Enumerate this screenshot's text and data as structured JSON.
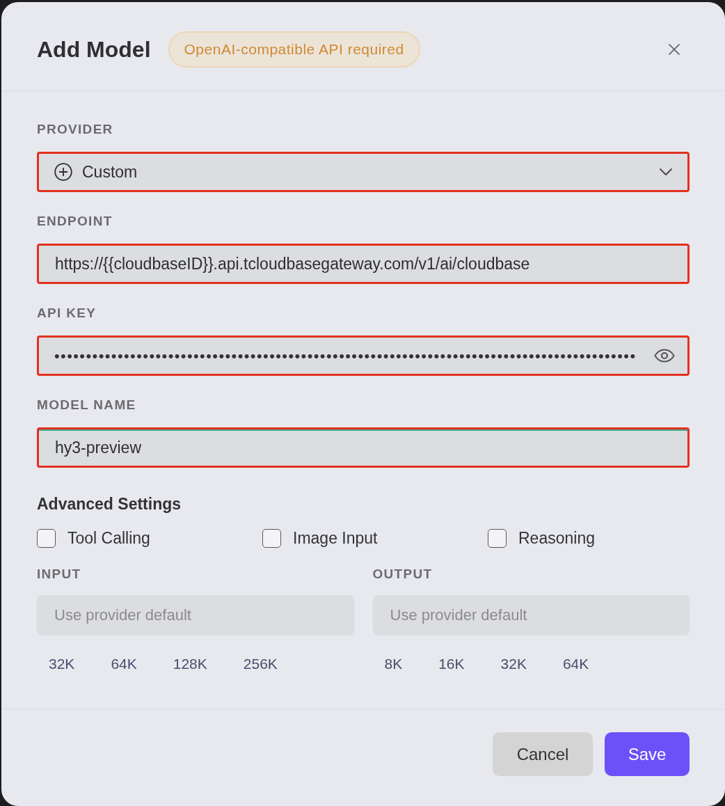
{
  "dialog": {
    "title": "Add Model",
    "badge": "OpenAI-compatible API required"
  },
  "fields": [
    {
      "label": "PROVIDER",
      "kind": "select",
      "value": "Custom",
      "highlighted": true,
      "focused": false
    },
    {
      "label": "ENDPOINT",
      "kind": "text",
      "value": "https://{{cloudbaseID}}.api.tcloudbasegateway.com/v1/ai/cloudbase",
      "highlighted": true,
      "focused": false
    },
    {
      "label": "API KEY",
      "kind": "password",
      "value": "••••••••••••••••••••••••••••••••••••••••••••••••••••••••••••••••••••••••••••••••••••••••••••",
      "highlighted": true,
      "focused": false
    },
    {
      "label": "MODEL NAME",
      "kind": "text",
      "value": "hy3-preview",
      "highlighted": true,
      "focused": true
    }
  ],
  "advanced_settings": {
    "title": "Advanced Settings",
    "options": [
      {
        "label": "Tool Calling",
        "checked": false
      },
      {
        "label": "Image Input",
        "checked": false
      },
      {
        "label": "Reasoning",
        "checked": false
      }
    ],
    "limits": [
      {
        "label": "INPUT",
        "placeholder": "Use provider default",
        "presets": [
          "32K",
          "64K",
          "128K",
          "256K"
        ]
      },
      {
        "label": "OUTPUT",
        "placeholder": "Use provider default",
        "presets": [
          "8K",
          "16K",
          "32K",
          "64K"
        ]
      }
    ]
  },
  "buttons": [
    {
      "label": "Cancel",
      "kind": "secondary"
    },
    {
      "label": "Save",
      "kind": "primary"
    }
  ]
}
